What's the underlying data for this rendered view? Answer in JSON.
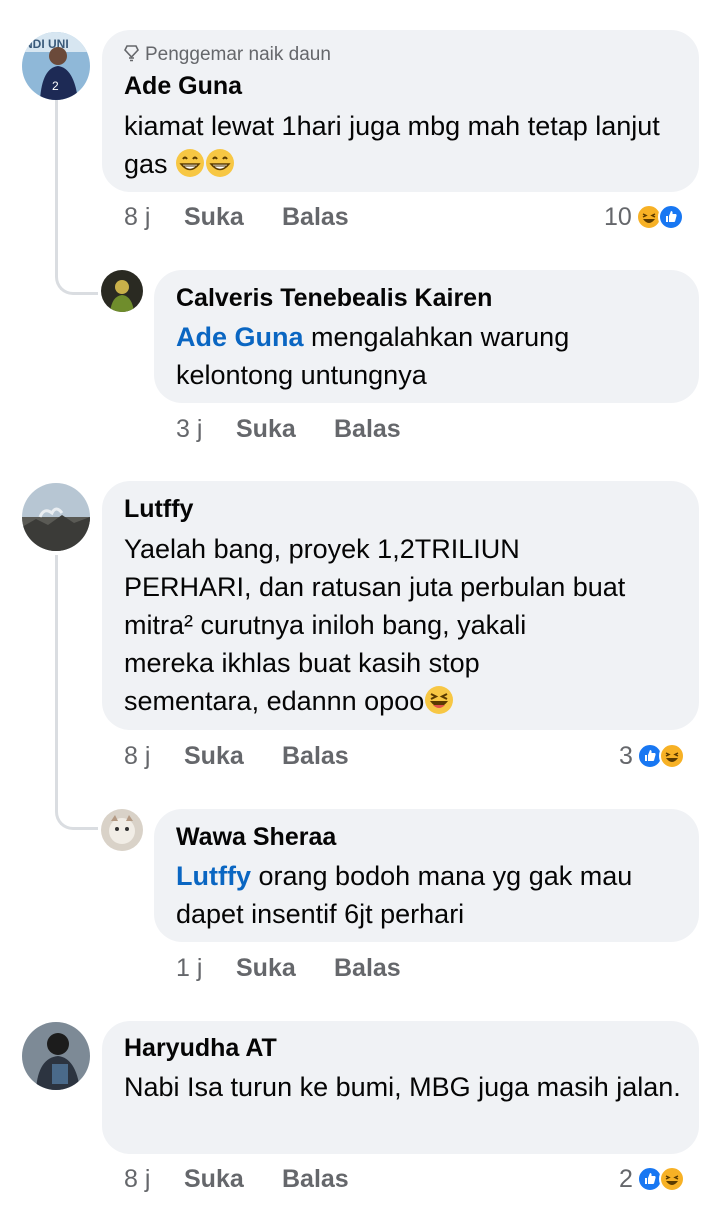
{
  "comments": [
    {
      "badge": "Penggemar naik daun",
      "author": "Ade Guna",
      "text": "kiamat lewat 1hari juga mbg mah tetap lanjut gas",
      "time": "8 j",
      "like": "Suka",
      "reply": "Balas",
      "reaction_count": "10",
      "reactions": [
        "haha-icon",
        "like-icon"
      ]
    },
    {
      "author": "Calveris Tenebealis Kairen",
      "mention": "Ade Guna",
      "text": "mengalahkan warung kelontong untungnya",
      "time": "3 j",
      "like": "Suka",
      "reply": "Balas"
    },
    {
      "author": "Lutffy",
      "text_lines": [
        "Yaelah bang, proyek 1,2TRILIUN",
        "PERHARI, dan ratusan juta perbulan buat",
        "mitra² curutnya iniloh bang, yakali",
        "mereka ikhlas buat kasih stop",
        "sementara, edannn opoo"
      ],
      "time": "8 j",
      "like": "Suka",
      "reply": "Balas",
      "reaction_count": "3",
      "reactions": [
        "like-icon",
        "haha-icon"
      ]
    },
    {
      "author": "Wawa Sheraa",
      "mention": "Lutffy",
      "text": "orang bodoh mana yg gak mau dapet insentif 6jt perhari",
      "time": "1 j",
      "like": "Suka",
      "reply": "Balas"
    },
    {
      "author": "Haryudha AT",
      "text": "Nabi Isa turun ke bumi, MBG juga masih jalan.",
      "time": "8 j",
      "like": "Suka",
      "reply": "Balas",
      "reaction_count": "2",
      "reactions": [
        "like-icon",
        "haha-icon"
      ]
    }
  ],
  "colors": {
    "bubble": "#f0f2f5",
    "mention": "#0a66c2",
    "meta": "#65676b",
    "like": "#1877f2",
    "haha": "#f7b125"
  }
}
